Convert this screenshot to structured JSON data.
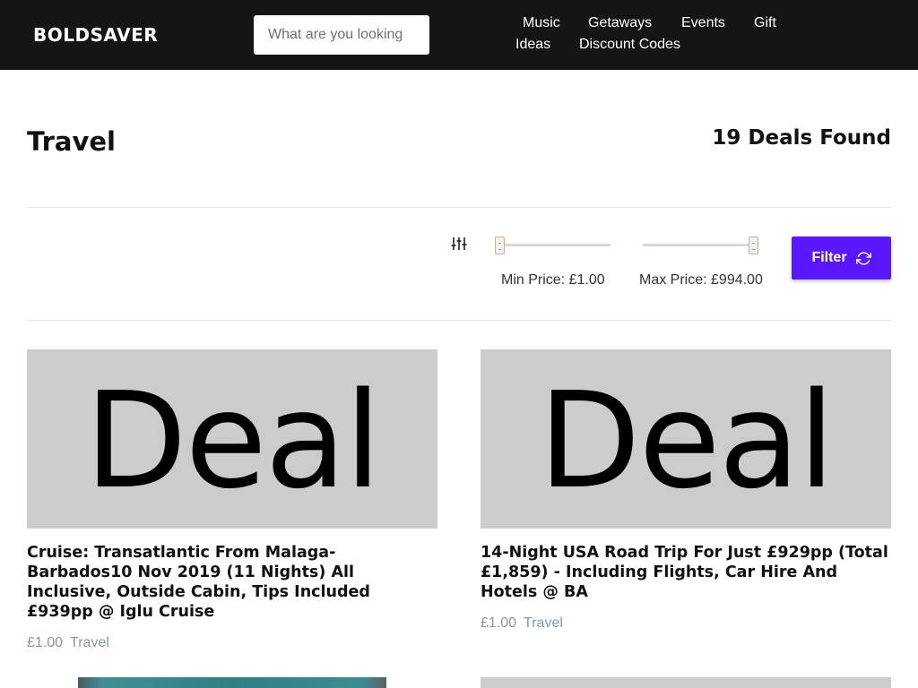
{
  "header": {
    "logo": "BOLDSAVER",
    "search": {
      "placeholder": "What are you looking",
      "value": ""
    },
    "nav": [
      {
        "label": "Music"
      },
      {
        "label": "Getaways"
      },
      {
        "label": "Events"
      },
      {
        "label": "Gift"
      },
      {
        "label": "Ideas"
      },
      {
        "label": "Discount Codes"
      }
    ]
  },
  "page": {
    "title": "Travel",
    "deals_count": "19 Deals Found"
  },
  "filter": {
    "icon": "sliders-icon",
    "min_price_label": "Min Price: £1.00",
    "max_price_label": "Max Price: £994.00",
    "min_slider_level": 0,
    "max_slider_level": 1,
    "button_label": "Filter",
    "button_icon": "refresh-icon",
    "accent_color": "#5a17ff"
  },
  "deals": [
    {
      "image_text": "Deal",
      "title": "Cruise: Transatlantic From Malaga-Barbados10 Nov 2019 (11 Nights) All Inclusive, Outside Cabin, Tips Included £939pp @ Iglu Cruise",
      "price": "£1.00",
      "category": "Travel"
    },
    {
      "image_text": "Deal",
      "title": "14-Night USA Road Trip For Just £929pp (Total £1,859) - Including Flights, Car Hire And Hotels @ BA",
      "price": "£1.00",
      "category": "Travel"
    }
  ]
}
